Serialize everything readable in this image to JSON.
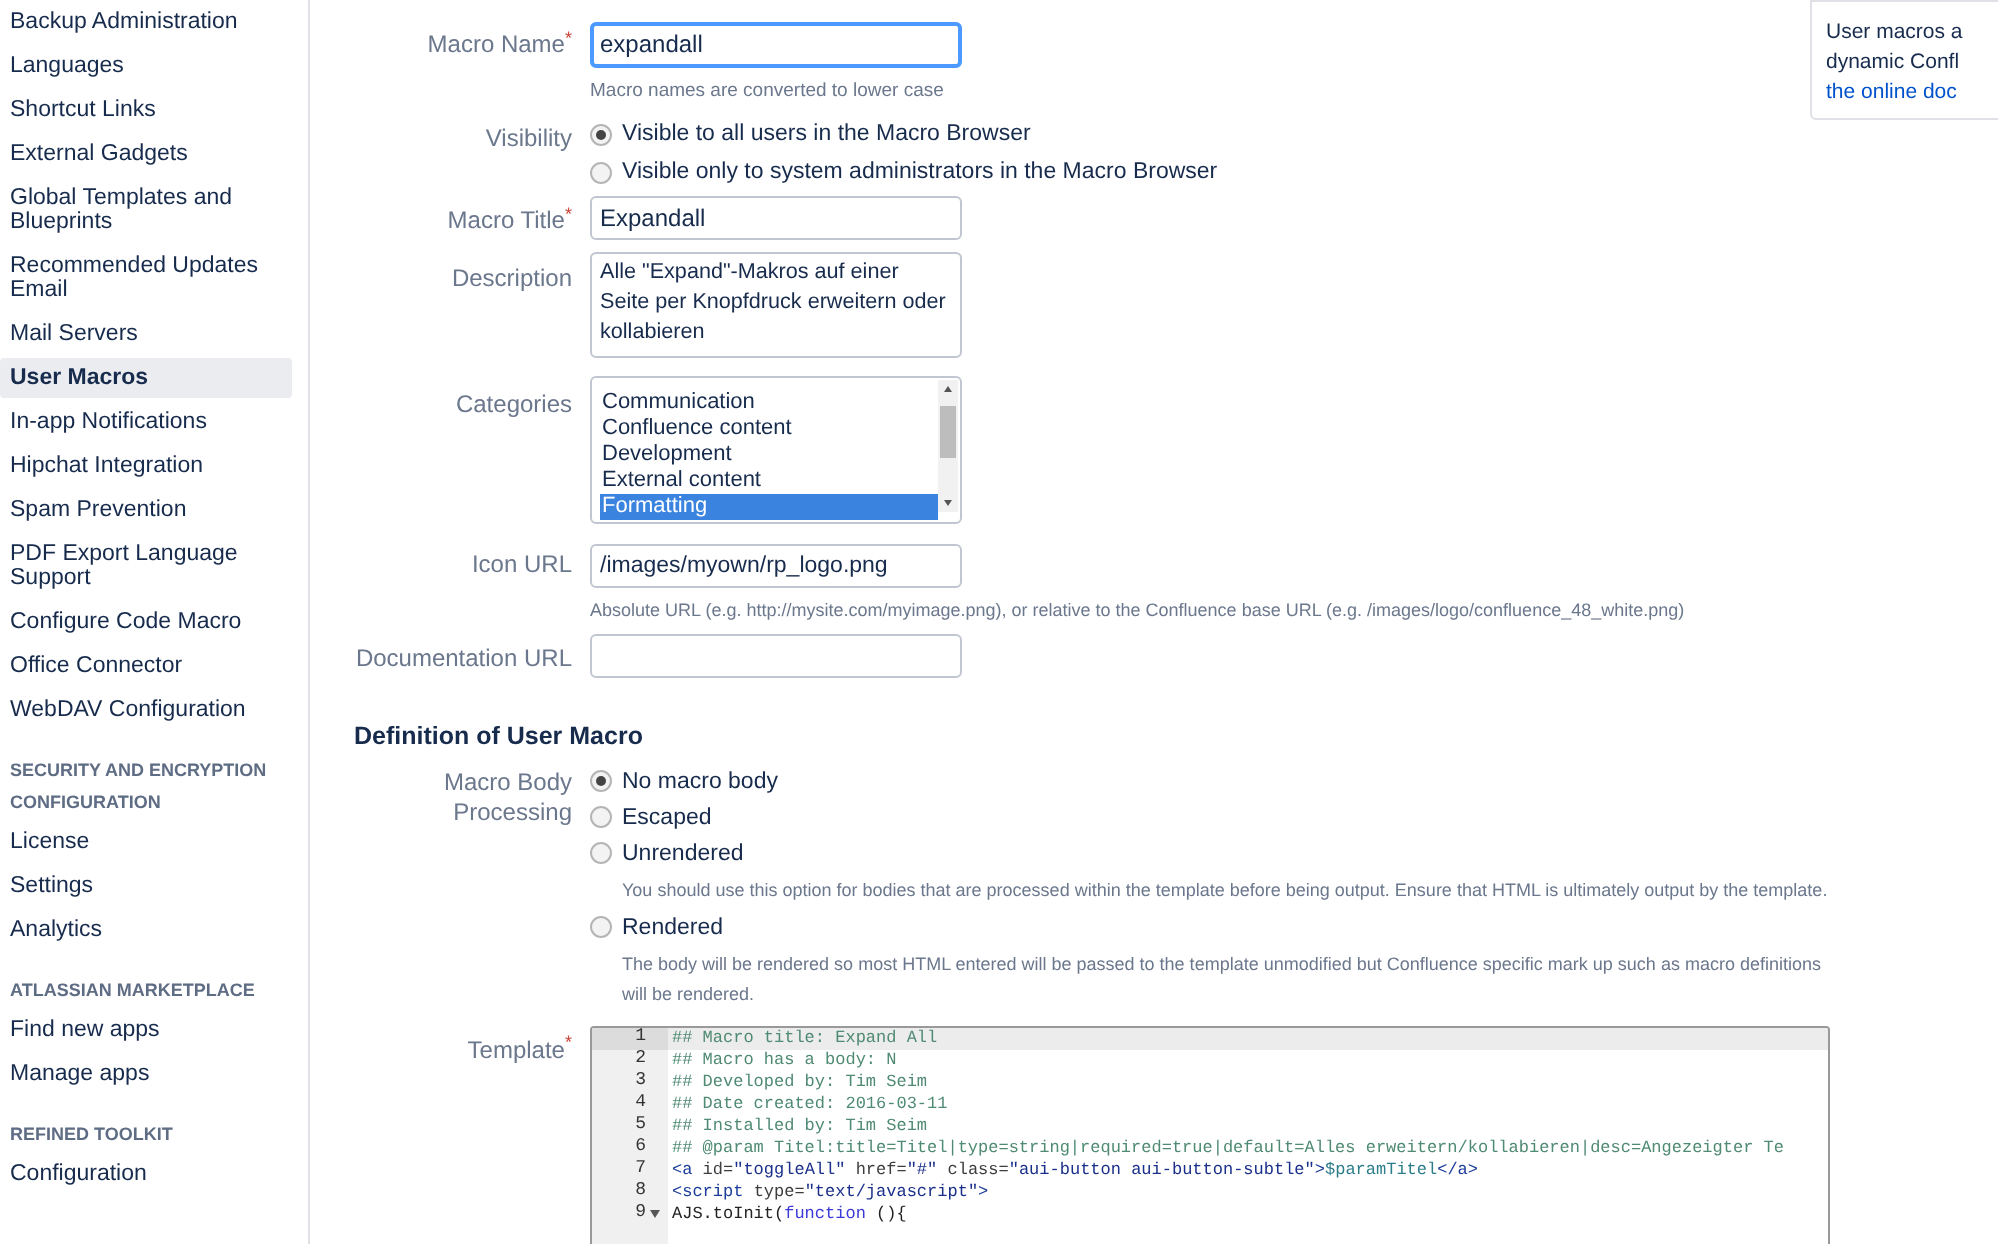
{
  "sidebar": {
    "groups": [
      {
        "items": [
          {
            "label": "Backup Administration",
            "selected": false
          },
          {
            "label": "Languages",
            "selected": false
          },
          {
            "label": "Shortcut Links",
            "selected": false
          },
          {
            "label": "External Gadgets",
            "selected": false
          },
          {
            "label": "Global Templates and Blueprints",
            "selected": false
          },
          {
            "label": "Recommended Updates Email",
            "selected": false
          },
          {
            "label": "Mail Servers",
            "selected": false
          },
          {
            "label": "User Macros",
            "selected": true
          },
          {
            "label": "In-app Notifications",
            "selected": false
          },
          {
            "label": "Hipchat Integration",
            "selected": false
          },
          {
            "label": "Spam Prevention",
            "selected": false
          },
          {
            "label": "PDF Export Language Support",
            "selected": false
          },
          {
            "label": "Configure Code Macro",
            "selected": false
          },
          {
            "label": "Office Connector",
            "selected": false
          },
          {
            "label": "WebDAV Configuration",
            "selected": false
          }
        ]
      },
      {
        "heading": "SECURITY AND ENCRYPTION CONFIGURATION",
        "items": [
          {
            "label": "License",
            "selected": false
          },
          {
            "label": "Settings",
            "selected": false
          },
          {
            "label": "Analytics",
            "selected": false
          }
        ]
      },
      {
        "heading": "ATLASSIAN MARKETPLACE",
        "items": [
          {
            "label": "Find new apps",
            "selected": false
          },
          {
            "label": "Manage apps",
            "selected": false
          }
        ]
      },
      {
        "heading": "REFINED TOOLKIT",
        "items": [
          {
            "label": "Configuration",
            "selected": false
          }
        ]
      }
    ]
  },
  "macro_name": {
    "label": "Macro Name",
    "required_mark": "*",
    "value": "expandall",
    "hint": "Macro names are converted to lower case"
  },
  "visibility": {
    "label": "Visibility",
    "options": [
      {
        "label": "Visible to all users in the Macro Browser",
        "selected": true
      },
      {
        "label": "Visible only to system administrators in the Macro Browser",
        "selected": false
      }
    ]
  },
  "macro_title": {
    "label": "Macro Title",
    "required_mark": "*",
    "value": "Expandall"
  },
  "description": {
    "label": "Description",
    "value": "Alle \"Expand\"-Makros auf einer Seite per Knopfdruck erweitern oder kollabieren"
  },
  "categories": {
    "label": "Categories",
    "options": [
      {
        "label": "Communication",
        "selected": false
      },
      {
        "label": "Confluence content",
        "selected": false
      },
      {
        "label": "Development",
        "selected": false
      },
      {
        "label": "External content",
        "selected": false
      },
      {
        "label": "Formatting",
        "selected": true
      }
    ]
  },
  "icon_url": {
    "label": "Icon URL",
    "value": "/images/myown/rp_logo.png",
    "hint": "Absolute URL (e.g. http://mysite.com/myimage.png), or relative to the Confluence base URL (e.g. /images/logo/confluence_48_white.png)"
  },
  "documentation_url": {
    "label": "Documentation URL"
  },
  "definition": {
    "heading": "Definition of User Macro",
    "body_processing": {
      "label": "Macro Body Processing",
      "options": [
        {
          "label": "No macro body",
          "selected": true
        },
        {
          "label": "Escaped",
          "selected": false
        },
        {
          "label": "Unrendered",
          "selected": false,
          "hint": "You should use this option for bodies that are processed within the template before being output. Ensure that HTML is ultimately output by the template."
        },
        {
          "label": "Rendered",
          "selected": false,
          "hint": "The body will be rendered so most HTML entered will be passed to the template unmodified but Confluence specific mark up such as macro definitions will be rendered."
        }
      ]
    },
    "template": {
      "label": "Template",
      "required_mark": "*",
      "lines": [
        {
          "number": "1",
          "active": true,
          "fold": false,
          "segments": [
            {
              "kind": "comment",
              "text": "## Macro title: Expand All"
            }
          ]
        },
        {
          "number": "2",
          "active": false,
          "fold": false,
          "segments": [
            {
              "kind": "comment",
              "text": "## Macro has a body: N"
            }
          ]
        },
        {
          "number": "3",
          "active": false,
          "fold": false,
          "segments": [
            {
              "kind": "comment",
              "text": "## Developed by: Tim Seim"
            }
          ]
        },
        {
          "number": "4",
          "active": false,
          "fold": false,
          "segments": [
            {
              "kind": "comment",
              "text": "## Date created: 2016-03-11"
            }
          ]
        },
        {
          "number": "5",
          "active": false,
          "fold": false,
          "segments": [
            {
              "kind": "comment",
              "text": "## Installed by: Tim Seim"
            }
          ]
        },
        {
          "number": "6",
          "active": false,
          "fold": false,
          "segments": [
            {
              "kind": "comment",
              "text": "## @param Titel:title=Titel|type=string|required=true|default=Alles erweitern/kollabieren|desc=Angezeigter Te"
            }
          ]
        },
        {
          "number": "7",
          "active": false,
          "fold": false,
          "segments": [
            {
              "kind": "tag",
              "text": "<a"
            },
            {
              "kind": "attr",
              "text": " id="
            },
            {
              "kind": "string",
              "text": "\"toggleAll\""
            },
            {
              "kind": "attr",
              "text": " href="
            },
            {
              "kind": "string",
              "text": "\"#\""
            },
            {
              "kind": "attr",
              "text": " class="
            },
            {
              "kind": "string",
              "text": "\"aui-button aui-button-subtle\""
            },
            {
              "kind": "tag",
              "text": ">"
            },
            {
              "kind": "variable",
              "text": "$paramTitel"
            },
            {
              "kind": "tag",
              "text": "</a>"
            }
          ]
        },
        {
          "number": "8",
          "active": false,
          "fold": false,
          "segments": [
            {
              "kind": "tag",
              "text": "<script"
            },
            {
              "kind": "attr",
              "text": " type="
            },
            {
              "kind": "string",
              "text": "\"text/javascript\""
            },
            {
              "kind": "tag",
              "text": ">"
            }
          ]
        },
        {
          "number": "9",
          "active": false,
          "fold": true,
          "segments": [
            {
              "kind": "plain",
              "text": "AJS.toInit("
            },
            {
              "kind": "keyword",
              "text": "function"
            },
            {
              "kind": "plain",
              "text": " (){"
            }
          ]
        }
      ]
    }
  },
  "info_panel": {
    "lines": [
      "User macros a",
      "dynamic Confl"
    ],
    "link": "the online doc"
  }
}
